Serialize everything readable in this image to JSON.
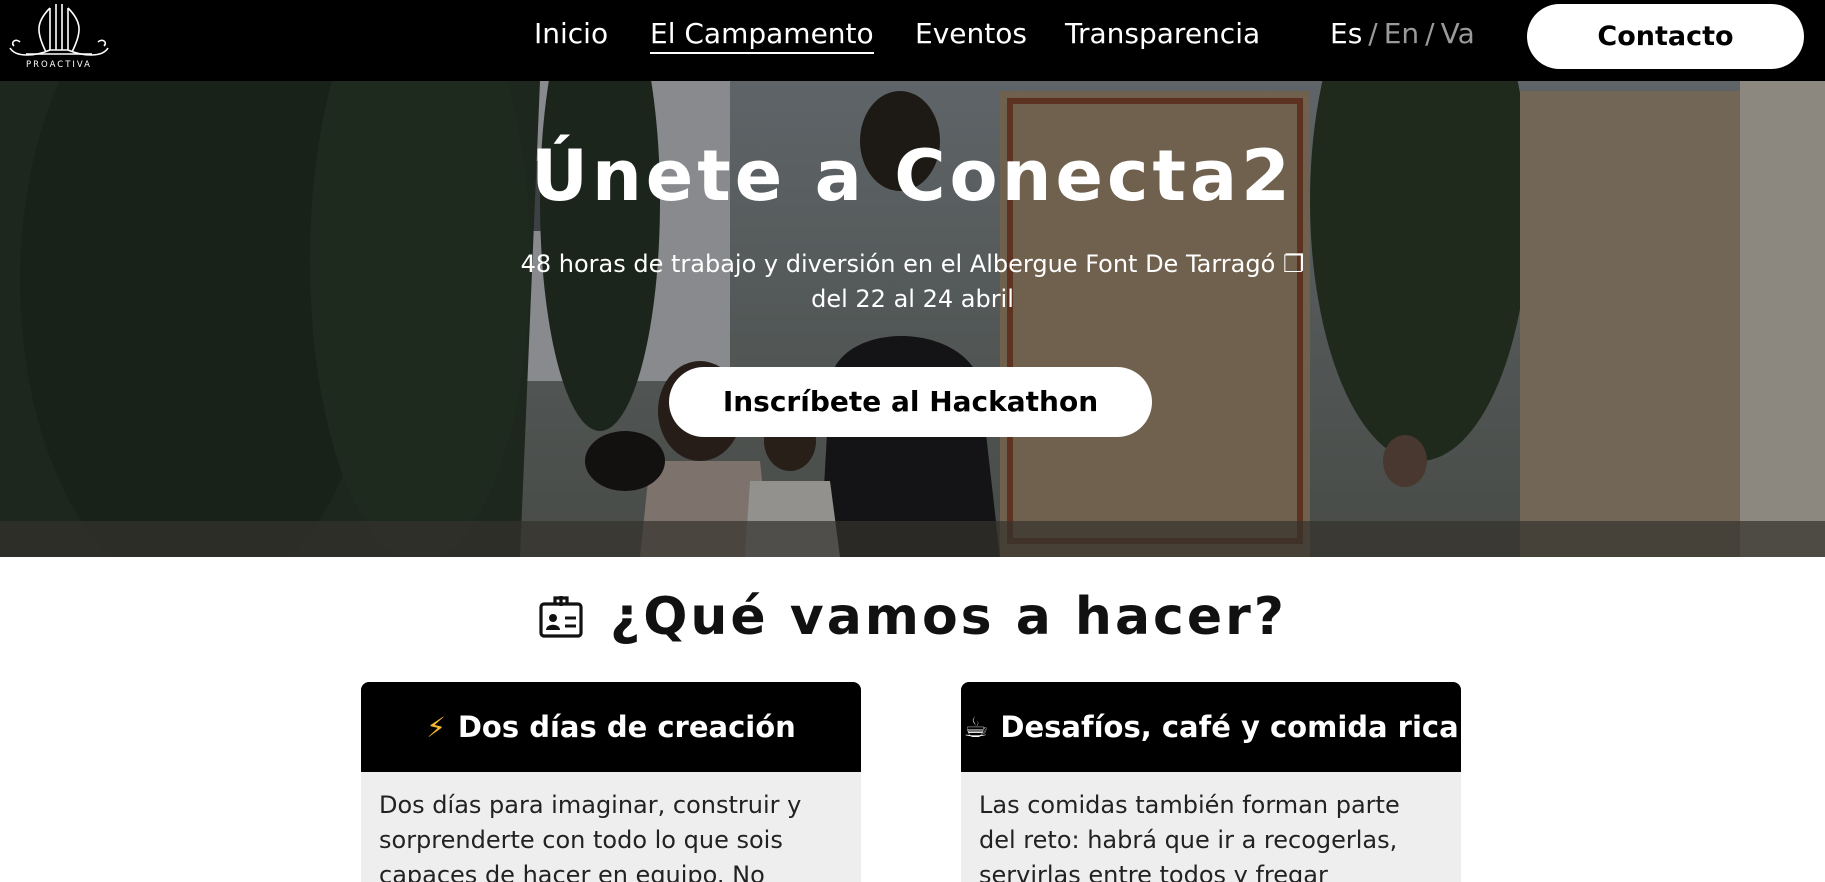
{
  "nav": {
    "logo_text": "PROACTIVA",
    "links": [
      {
        "label": "Inicio"
      },
      {
        "label": "El Campamento"
      },
      {
        "label": "Eventos"
      },
      {
        "label": "Transparencia"
      }
    ],
    "languages": [
      "Es",
      "En",
      "Va"
    ],
    "separator": "/",
    "contact_label": "Contacto"
  },
  "hero": {
    "title": "Únete a Conecta2",
    "subtitle_line1": "48 horas de trabajo y diversión en el Albergue Font De Tarragó ❐",
    "subtitle_line2": "del 22 al 24 abril",
    "cta_label": "Inscríbete al Hackathon"
  },
  "section": {
    "icon": "id-badge-icon",
    "title": "¿Qué vamos a hacer?",
    "cards": [
      {
        "emoji": "⚡",
        "title": "Dos días de creación",
        "body": "Dos días para imaginar, construir y sorprenderte con todo lo que sois capaces de hacer en equipo. No"
      },
      {
        "emoji": "☕",
        "title": "Desafíos, café y comida rica",
        "body": "Las comidas también forman parte del reto: habrá que ir a recogerlas, servirlas entre todos y fregar después."
      }
    ]
  },
  "colors": {
    "navbar_bg": "#000000",
    "accent_white": "#ffffff",
    "inactive_lang": "#9a9a9a",
    "card_head_bg": "#000000",
    "card_body_bg": "#eeeeee",
    "bolt_color": "#f5b82e"
  }
}
